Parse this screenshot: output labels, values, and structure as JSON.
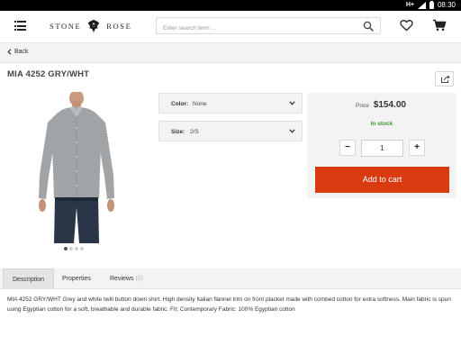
{
  "status_bar": {
    "network": "H+",
    "time": "08:30"
  },
  "header": {
    "logo_left": "STONE",
    "logo_right": "ROSE",
    "search_placeholder": "Enter search term ..."
  },
  "nav": {
    "back_label": "Back"
  },
  "product": {
    "title": "MIA 4252 GRY/WHT",
    "image_count": 4,
    "active_image": 1,
    "options": [
      {
        "label": "Color:",
        "value": "None"
      },
      {
        "label": "Size:",
        "value": "2/S"
      }
    ],
    "price_label": "Price",
    "price": "$154.00",
    "stock": "In stock",
    "quantity": "1",
    "minus_label": "−",
    "plus_label": "+",
    "add_to_cart": "Add to cart"
  },
  "tabs": {
    "description": "Description",
    "properties": "Properties",
    "reviews": "Reviews",
    "reviews_count": "(0)"
  },
  "description_text": "MIA 4252 GRY/WHT Grey and white twill button down shirt. High density Italian flannel trim on front placket made with combed cotton for extra softness. Main fabric is spun using Egyptian cotton for a soft, breathable and durable fabric. Fit: Contemporary Fabric: 100% Egyptian cotton",
  "colors": {
    "accent": "#d93a10",
    "in_stock": "#3c9a31",
    "panel": "#f3f3f3"
  }
}
